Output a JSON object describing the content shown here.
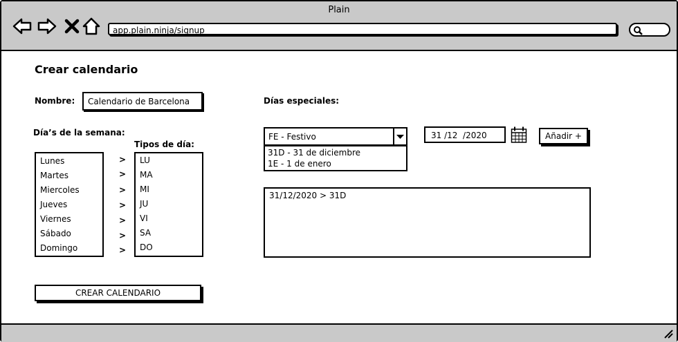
{
  "window": {
    "title": "Plain",
    "url": "app.plain.ninja/signup"
  },
  "page": {
    "heading": "Crear calendario"
  },
  "form": {
    "nombre_label": "Nombre:",
    "nombre_value": "Calendario de Barcelona",
    "dias_semana_label": "Día’s de la semana:",
    "tipos_dia_label": "Tipos de día:",
    "weekdays": [
      "Lunes",
      "Martes",
      "Miercoles",
      "Jueves",
      "Viernes",
      "Sábado",
      "Domingo"
    ],
    "arrow": ">",
    "day_types": [
      "LU",
      "MA",
      "MI",
      "JU",
      "VI",
      "SA",
      "DO"
    ],
    "create_button": "CREAR CALENDARIO"
  },
  "special_days": {
    "label": "Días especiales:",
    "select_value": "FE - Festivo",
    "options": [
      "31D - 31 de diciembre",
      "1E - 1 de enero"
    ],
    "date_value": "31 /12  /2020",
    "add_button": "Añadir +",
    "entries": [
      "31/12/2020 > 31D"
    ]
  }
}
